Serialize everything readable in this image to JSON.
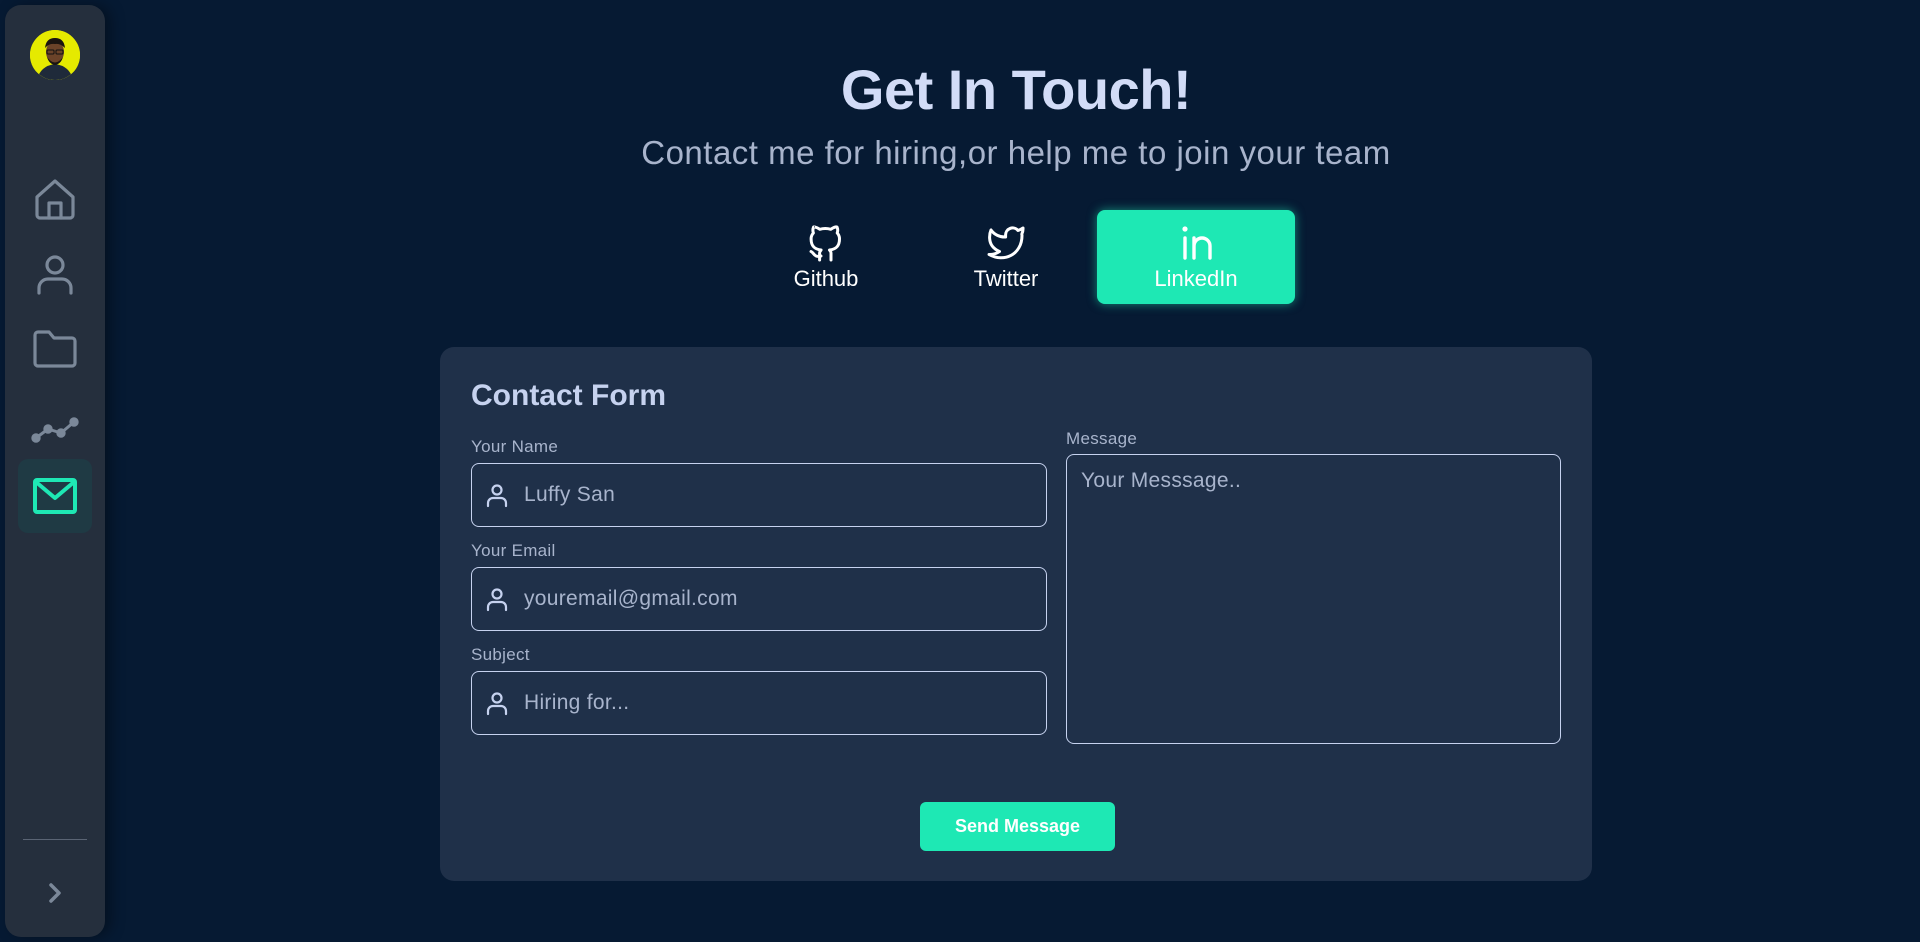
{
  "header": {
    "title": "Get In Touch!",
    "subtitle": "Contact me for hiring,or help me to join your team"
  },
  "sidebar": {
    "items": [
      {
        "icon": "home-icon",
        "active": false
      },
      {
        "icon": "user-icon",
        "active": false
      },
      {
        "icon": "folder-icon",
        "active": false
      },
      {
        "icon": "chart-line-icon",
        "active": false
      },
      {
        "icon": "mail-icon",
        "active": true
      }
    ],
    "expand_icon": "chevron-right-icon"
  },
  "social": {
    "github": {
      "label": "Github",
      "icon": "github-icon"
    },
    "twitter": {
      "label": "Twitter",
      "icon": "twitter-icon"
    },
    "linkedin": {
      "label": "LinkedIn",
      "icon": "linkedin-icon",
      "active": true
    }
  },
  "form": {
    "title": "Contact Form",
    "name": {
      "label": "Your Name",
      "placeholder": "Luffy San"
    },
    "email": {
      "label": "Your Email",
      "placeholder": "youremail@gmail.com"
    },
    "subject": {
      "label": "Subject",
      "placeholder": "Hiring for..."
    },
    "message": {
      "label": "Message",
      "placeholder": "Your Messsage.."
    },
    "submit_label": "Send Message"
  },
  "colors": {
    "background": "#061a33",
    "sidebar": "#252f3d",
    "card": "#1f3049",
    "accent": "#1ee8b4",
    "heading": "#d2dcf7",
    "muted": "#a8b4cc"
  }
}
